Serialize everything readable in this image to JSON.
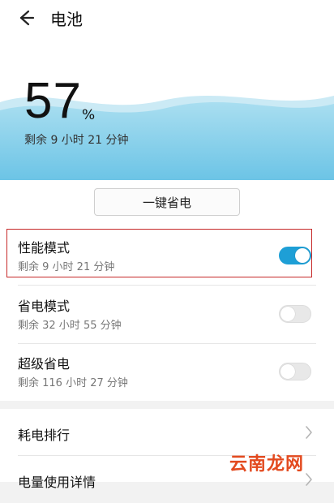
{
  "header": {
    "title": "电池",
    "back_icon": "back-arrow-icon"
  },
  "battery": {
    "percent": "57",
    "percent_sign": "%",
    "remaining": "剩余 9 小时 21 分钟",
    "level": 0.57,
    "wave_color": "#8fd4ec"
  },
  "one_key_save": {
    "label": "一键省电"
  },
  "modes": [
    {
      "name": "性能模式",
      "remaining": "剩余 9 小时 21 分钟",
      "enabled": true
    },
    {
      "name": "省电模式",
      "remaining": "剩余 32 小时 55 分钟",
      "enabled": false
    },
    {
      "name": "超级省电",
      "remaining": "剩余 116 小时 27 分钟",
      "enabled": false
    }
  ],
  "nav": [
    {
      "label": "耗电排行"
    },
    {
      "label": "电量使用详情"
    }
  ],
  "watermark": {
    "text": "云南龙网"
  },
  "colors": {
    "accent": "#1e9fd6",
    "highlight": "#c62828",
    "watermark": "#e34a1f"
  }
}
